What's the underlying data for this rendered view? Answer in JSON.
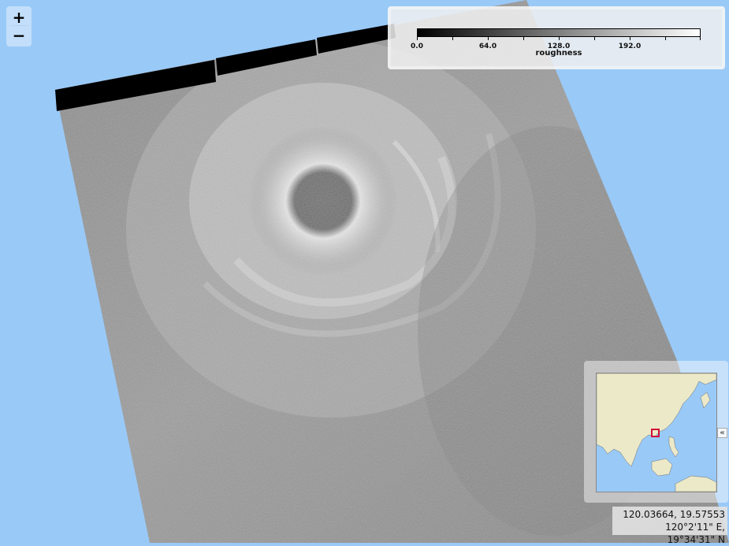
{
  "map": {
    "zoom_in_label": "+",
    "zoom_out_label": "−"
  },
  "legend": {
    "title": "roughness",
    "ticks": [
      "0.0",
      "64.0",
      "128.0",
      "192.0"
    ],
    "color_start": "#000000",
    "color_end": "#ffffff"
  },
  "overview": {
    "collapse_label": "«",
    "land_color": "#ece9c9",
    "water_color": "#99c9f7",
    "marker_color": "#d0103a"
  },
  "coordinates": {
    "decimal": "120.03664, 19.57553",
    "dms": "120°2'11\" E, 19°34'31\" N"
  },
  "colors": {
    "background": "#99c9f7"
  }
}
